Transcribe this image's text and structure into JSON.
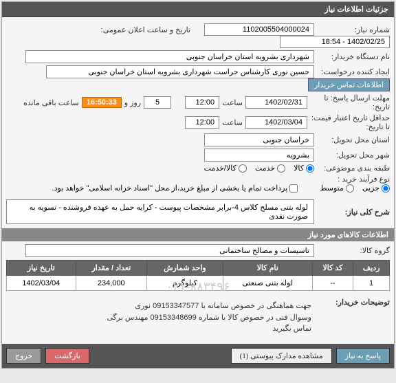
{
  "panel_title": "جزئیات اطلاعات نیاز",
  "fields": {
    "need_no_label": "شماره نیاز:",
    "need_no": "1102005504000024",
    "announce_label": "تاریخ و ساعت اعلان عمومی:",
    "announce_value": "1402/02/25 - 18:54",
    "buyer_org_label": "نام دستگاه خریدار:",
    "buyer_org": "شهرداری بشرویه استان خراسان جنوبی",
    "requester_label": "ایجاد کننده درخواست:",
    "requester": "حسین نوری کارشناس حراست شهرداری بشرویه استان خراسان جنوبی",
    "contact_btn": "اطلاعات تماس خریدار",
    "deadline_label": "مهلت ارسال پاسخ: تا تاریخ:",
    "deadline_date": "1402/02/31",
    "time_lbl": "ساعت",
    "deadline_time": "12:00",
    "days": "5",
    "days_lbl": "روز و",
    "countdown": "16:50:33",
    "remaining_lbl": "ساعت باقی مانده",
    "validity_label": "حداقل تاریخ اعتبار قیمت: تا تاریخ:",
    "validity_date": "1402/03/04",
    "validity_time": "12:00",
    "province_label": "استان محل تحویل:",
    "province": "خراسان جنوبی",
    "city_label": "شهر محل تحویل:",
    "city": "بشرویه",
    "category_label": "طبقه بندی موضوعی:",
    "process_label": "نوع فرآیند خرید :",
    "radio_goods": "کالا",
    "radio_service": "خدمت",
    "radio_goods_service": "کالا/خدمت",
    "radio_minor": "جزیی",
    "radio_medium": "متوسط",
    "partial_pay": "پرداخت تمام یا بخشی از مبلغ خرید،از محل \"اسناد خزانه اسلامی\" خواهد بود.",
    "desc_label": "شرح کلی نیاز:",
    "desc": "لوله بتنی مسلح کلاس 4-برابر مشخصات پیوست - کرایه حمل به عهده فروشنده - تسویه به صورت نقدی",
    "items_header": "اطلاعات کالاهای مورد نیاز",
    "group_label": "گروه کالا:",
    "group": "تاسیسات و مصالح ساختمانی",
    "watermark": "۰۲۱-۸۸۳۴۹۶",
    "buyer_notes_label": "توضیحات خریدار:",
    "buyer_notes": "جهت هماهنگی در خصوص سامانه با 09153347577 نوری\nوسوال فنی در خصوص کالا با شماره 09153348699 مهندس برگی\nتماس بگیرید"
  },
  "table": {
    "headers": [
      "ردیف",
      "کد کالا",
      "نام کالا",
      "واحد شمارش",
      "تعداد / مقدار",
      "تاریخ نیاز"
    ],
    "rows": [
      {
        "idx": "1",
        "code": "--",
        "name": "لوله بتنی صنعتی",
        "unit": "کیلوگرم",
        "qty": "234,000",
        "date": "1402/03/04"
      }
    ]
  },
  "buttons": {
    "respond": "پاسخ به نیاز",
    "attachments": "مشاهده مدارک پیوستی (1)",
    "back": "بازگشت",
    "exit": "خروج"
  }
}
